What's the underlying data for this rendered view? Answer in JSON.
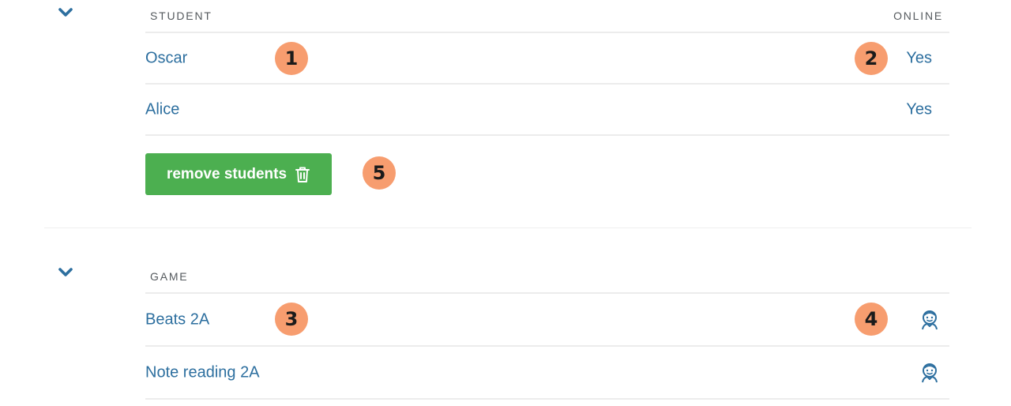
{
  "students_section": {
    "header": {
      "student_label": "STUDENT",
      "online_label": "ONLINE"
    },
    "rows": [
      {
        "name": "Oscar",
        "online": "Yes"
      },
      {
        "name": "Alice",
        "online": "Yes"
      }
    ],
    "remove_button_label": "remove students"
  },
  "games_section": {
    "header": {
      "game_label": "GAME"
    },
    "rows": [
      {
        "name": "Beats 2A",
        "icon": "student-face-icon"
      },
      {
        "name": "Note reading 2A",
        "icon": "student-face-icon"
      }
    ]
  },
  "markers": [
    "1",
    "2",
    "3",
    "4",
    "5"
  ],
  "colors": {
    "link": "#2d6f9f",
    "button": "#4caf50",
    "marker": "#f79d6f",
    "header_text": "#555a5e"
  }
}
